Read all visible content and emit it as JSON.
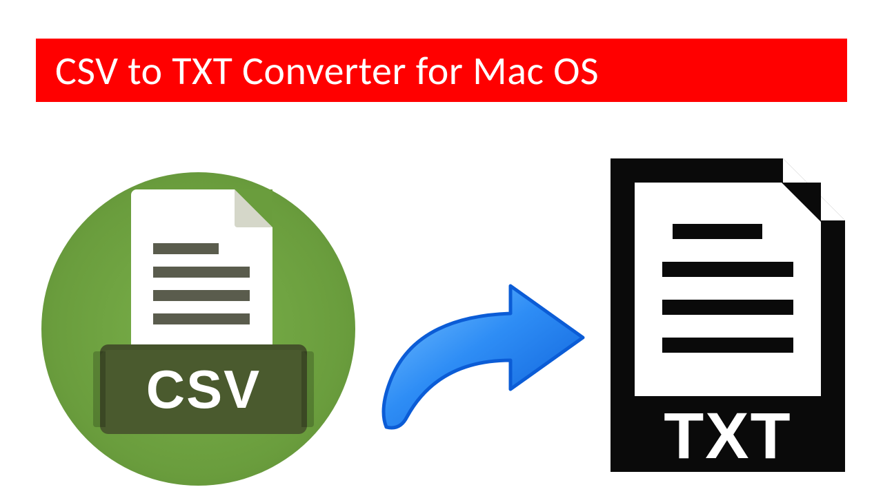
{
  "banner": {
    "title": "CSV to TXT Converter for Mac OS"
  },
  "csv": {
    "label": "CSV"
  },
  "txt": {
    "label": "TXT"
  },
  "colors": {
    "banner_bg": "#ff0000",
    "banner_text": "#ffffff",
    "circle": "#6a9d3d",
    "csv_band": "#4a5a2e",
    "arrow_light": "#4aa3ff",
    "arrow_dark": "#0b5cd6",
    "txt_icon": "#0a0a0a"
  }
}
